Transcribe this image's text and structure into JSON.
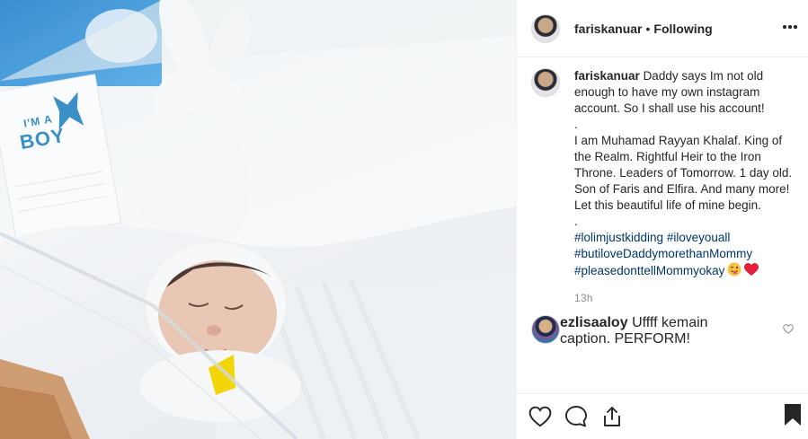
{
  "post": {
    "username": "fariskanuar",
    "separator": "•",
    "follow_status": "Following",
    "caption_user": "fariskanuar",
    "caption_lines": [
      "Daddy says Im not old enough to have my own instagram account. So I shall use his account!",
      ".",
      "I am Muhamad Rayyan Khalaf. King of the Realm. Rightful Heir to the Iron Throne. Leaders of Tomorrow. 1 day old. Son of Faris and Elfira. And many more! Let this beautiful life of mine begin.",
      "."
    ],
    "hashtags": [
      "#lolimjustkidding",
      "#iloveyouall",
      "#butiloveDaddymorethanMommy",
      "#pleasedonttellMommyokay"
    ],
    "emojis": [
      "winking-face-tongue",
      "red-heart"
    ],
    "time": "13h"
  },
  "reply": {
    "username": "ezlisaaloy",
    "text": "Uffff kemain caption. PERFORM!"
  },
  "photo": {
    "tag_top": "I'M A",
    "tag_main": "BOY"
  },
  "colors": {
    "link": "#00376b",
    "tag_blue": "#3a8fc6",
    "heart_red": "#ed4956"
  }
}
